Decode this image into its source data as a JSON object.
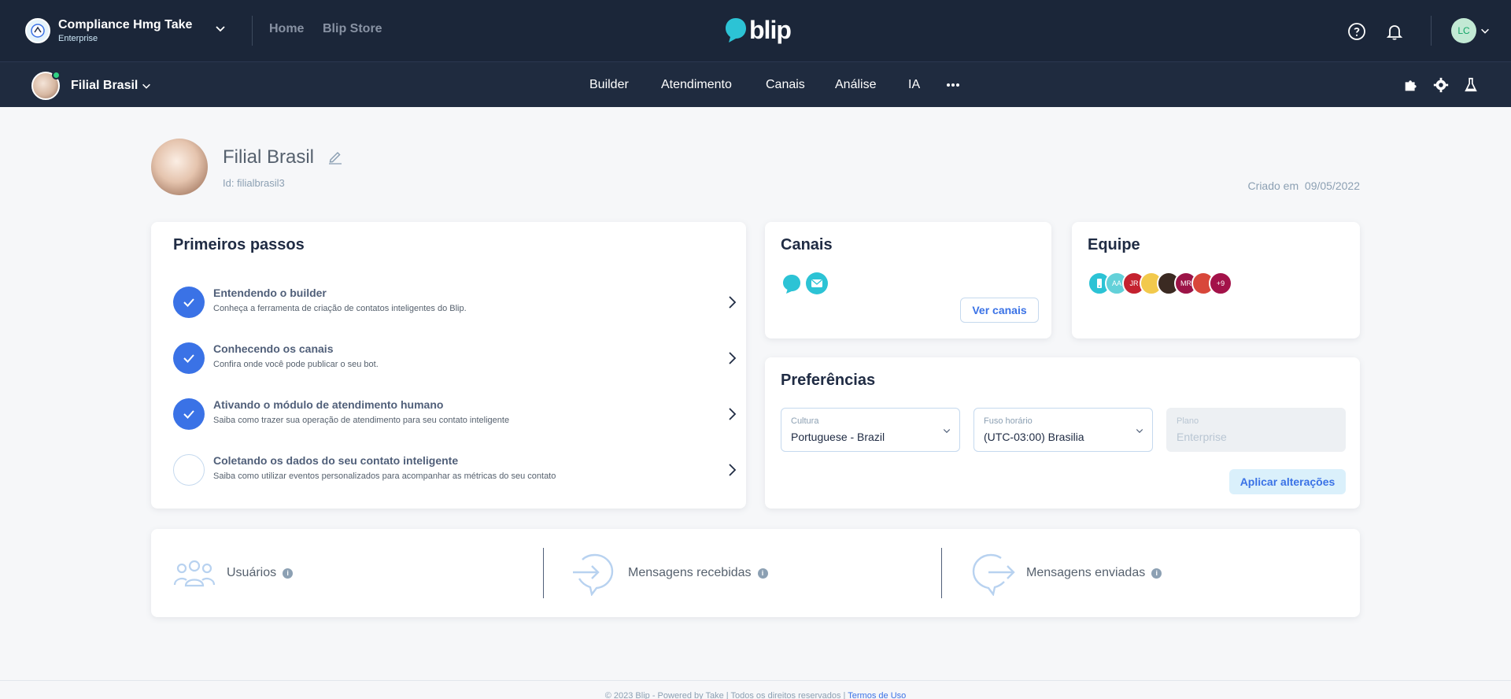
{
  "topbar": {
    "org_name": "Compliance Hmg Take",
    "org_type": "Enterprise",
    "links": [
      "Home",
      "Blip Store"
    ],
    "logo_text": "blip",
    "user_initials": "LC"
  },
  "subbar": {
    "bot_name": "Filial Brasil",
    "nav": [
      "Builder",
      "Atendimento",
      "Canais",
      "Análise",
      "IA"
    ]
  },
  "profile": {
    "name": "Filial Brasil",
    "id_label": "Id: filialbrasil3",
    "created_label": "Criado em",
    "created_date": "09/05/2022"
  },
  "steps_card": {
    "title": "Primeiros passos",
    "steps": [
      {
        "title": "Entendendo o builder",
        "desc": "Conheça a ferramenta de criação de contatos inteligentes do Blip.",
        "done": true
      },
      {
        "title": "Conhecendo os canais",
        "desc": "Confira onde você pode publicar o seu bot.",
        "done": true
      },
      {
        "title": "Ativando o módulo de atendimento humano",
        "desc": "Saiba como trazer sua operação de atendimento para seu contato inteligente",
        "done": true
      },
      {
        "title": "Coletando os dados do seu contato inteligente",
        "desc": "Saiba como utilizar eventos personalizados para acompanhar as métricas do seu contato",
        "done": false
      }
    ]
  },
  "channels_card": {
    "title": "Canais",
    "icons": [
      "blip-chat-icon",
      "email-icon"
    ],
    "button": "Ver canais"
  },
  "team_card": {
    "title": "Equipe",
    "members": [
      "",
      "AA",
      "JR",
      "",
      "",
      "MR",
      "",
      "+9"
    ]
  },
  "prefs_card": {
    "title": "Preferências",
    "culture": {
      "label": "Cultura",
      "value": "Portuguese - Brazil"
    },
    "timezone": {
      "label": "Fuso horário",
      "value": "(UTC-03:00) Brasilia"
    },
    "plan": {
      "label": "Plano",
      "value": "Enterprise"
    },
    "apply": "Aplicar alterações"
  },
  "stats": {
    "users": "Usuários",
    "received": "Mensagens recebidas",
    "sent": "Mensagens enviadas"
  },
  "footer": {
    "text": "© 2023 Blip - Powered by Take | Todos os direitos reservados |",
    "terms": "Termos de Uso"
  },
  "colors": {
    "accent": "#3a72e6",
    "header": "#1b2639",
    "online": "#2fd182"
  }
}
